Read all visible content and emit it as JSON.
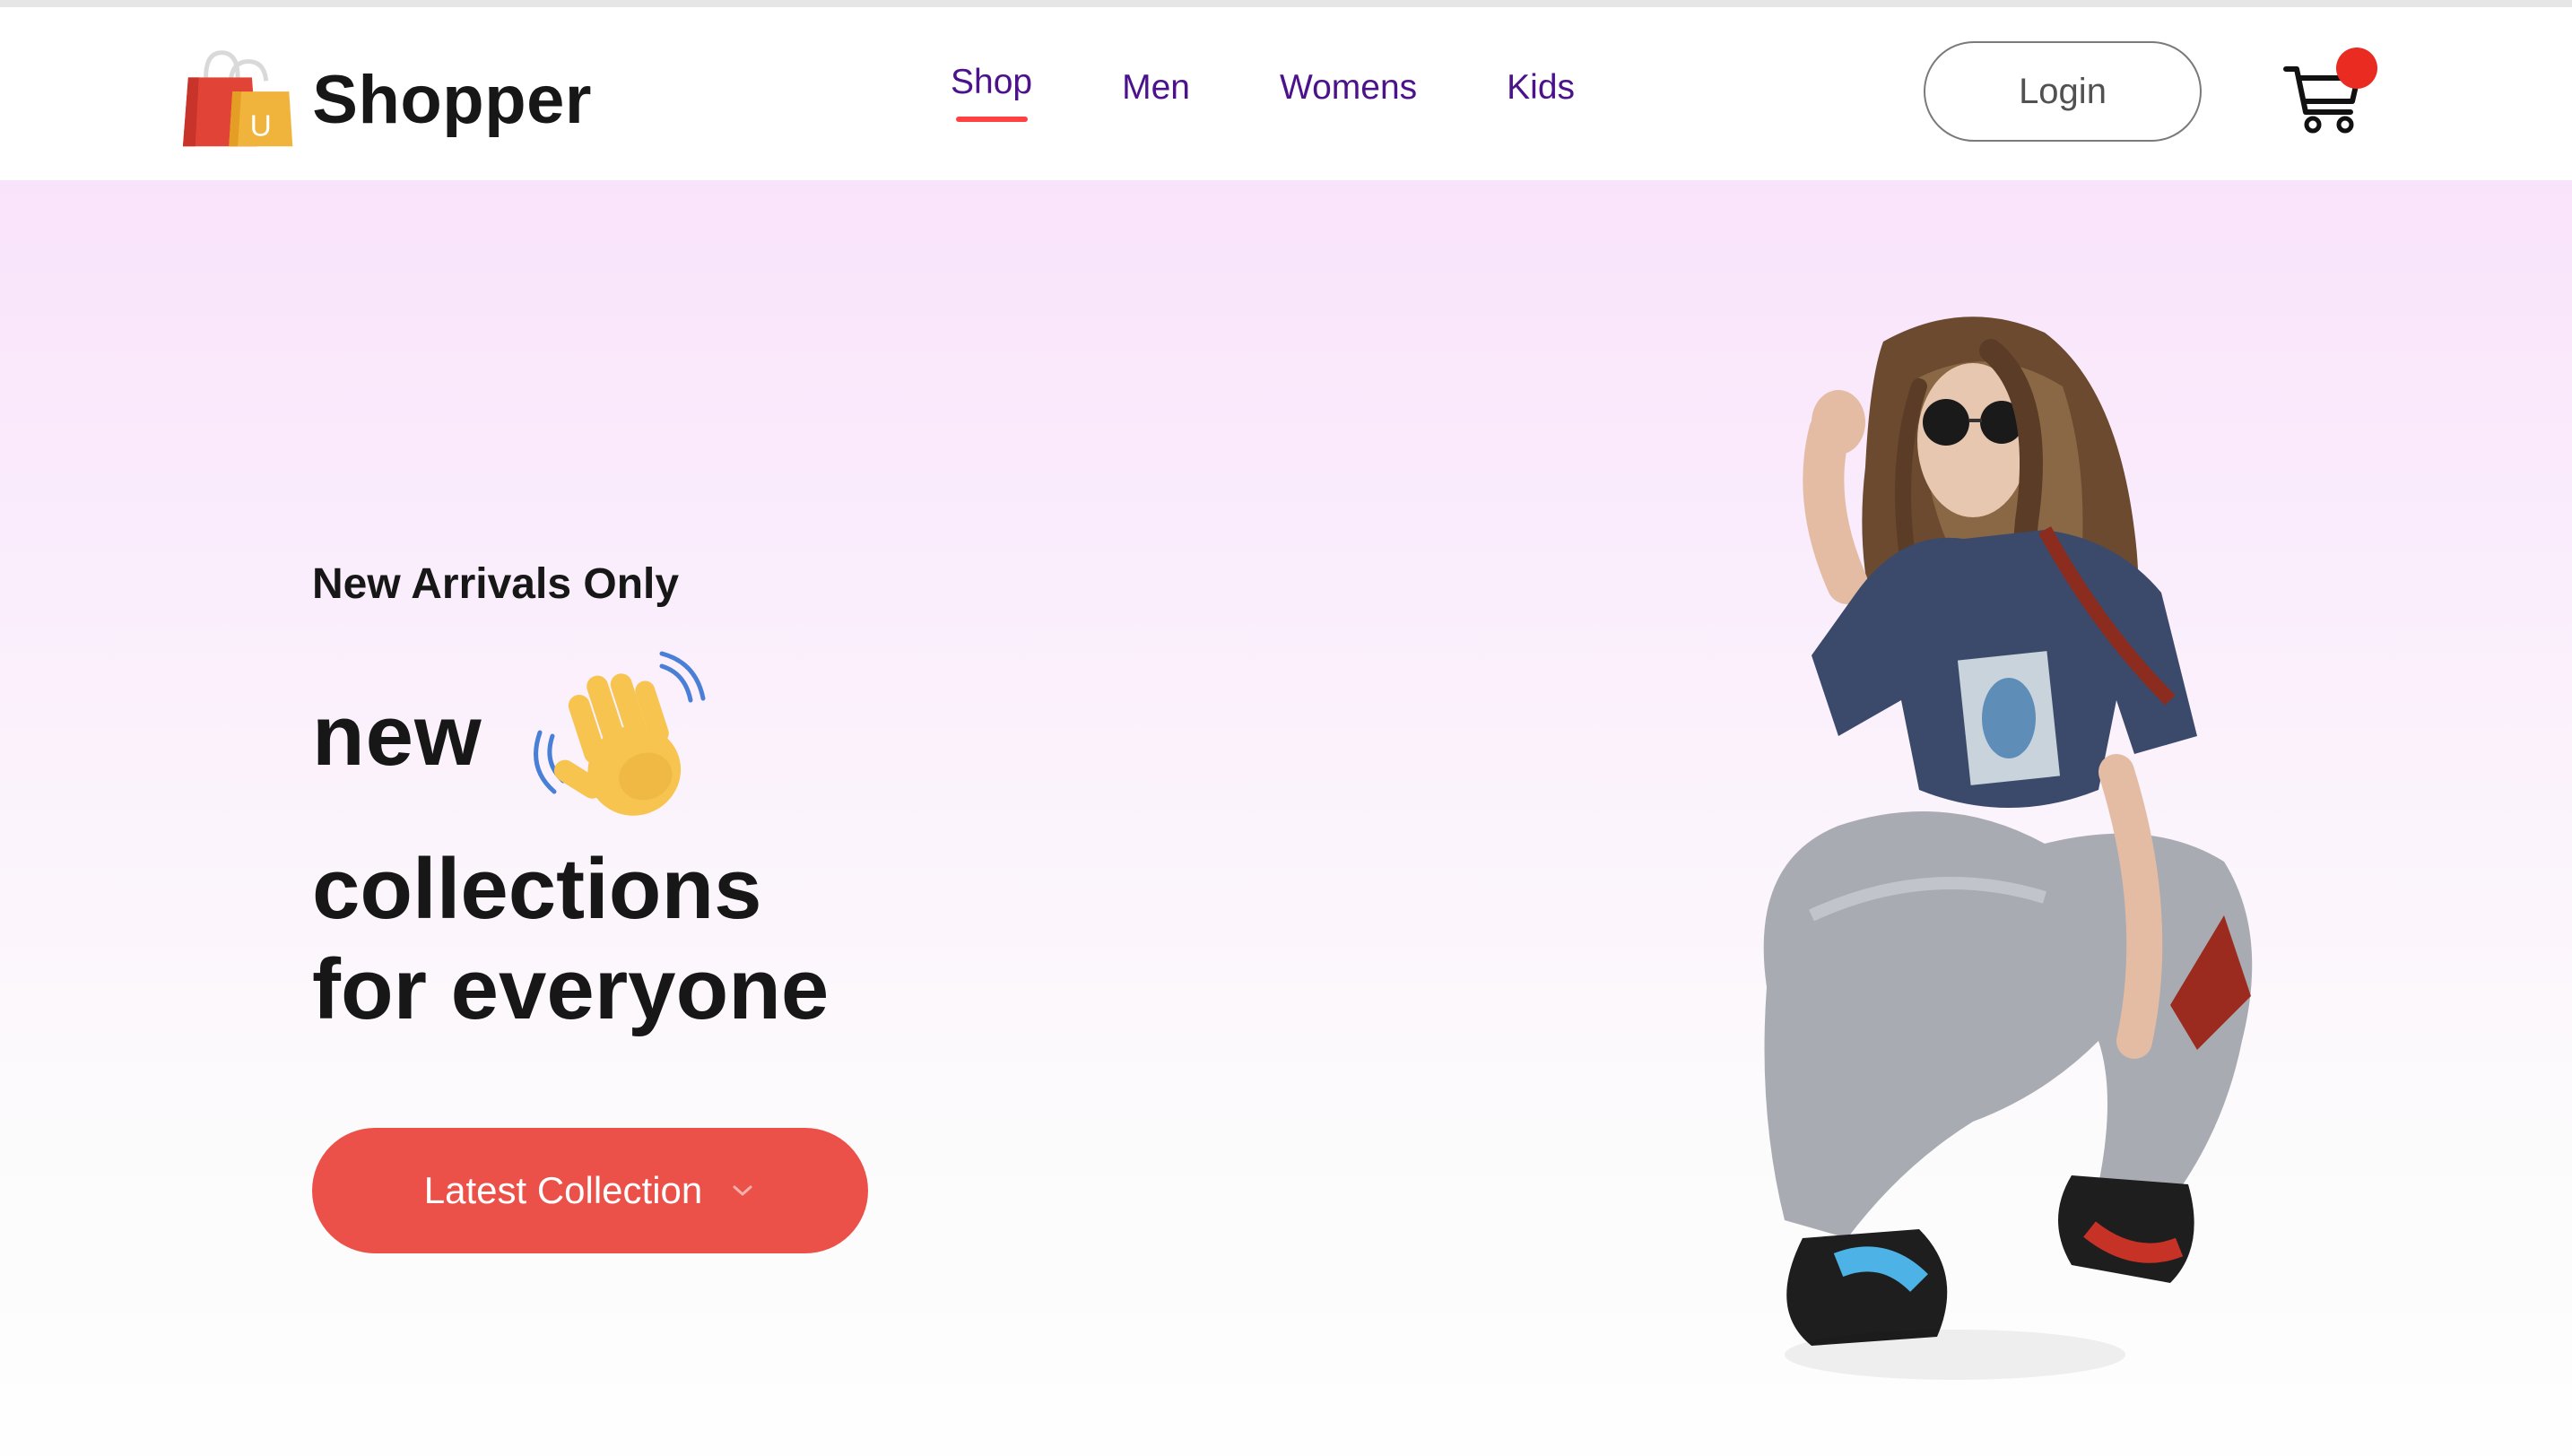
{
  "brand": {
    "name": "Shopper",
    "logo_icon": "shopping-bags-icon",
    "logo_letter": "U"
  },
  "nav": {
    "items": [
      {
        "label": "Shop",
        "active": true
      },
      {
        "label": "Men",
        "active": false
      },
      {
        "label": "Womens",
        "active": false
      },
      {
        "label": "Kids",
        "active": false
      }
    ]
  },
  "header": {
    "login_label": "Login",
    "cart_icon": "shopping-cart-icon"
  },
  "hero": {
    "kicker": "New Arrivals Only",
    "line1": "new",
    "line2": "collections",
    "line3": "for everyone",
    "wave_icon": "waving-hand-icon",
    "button_label": "Latest Collection",
    "button_icon": "chevron-down-icon",
    "image": "woman-squatting-model-image"
  },
  "colors": {
    "nav_text": "#4b128c",
    "accent": "#ff4141",
    "button": "#ec5149",
    "cart_badge": "#ea2b22",
    "hero_top": "#f9e3fb",
    "hero_bottom": "#fefefe"
  }
}
